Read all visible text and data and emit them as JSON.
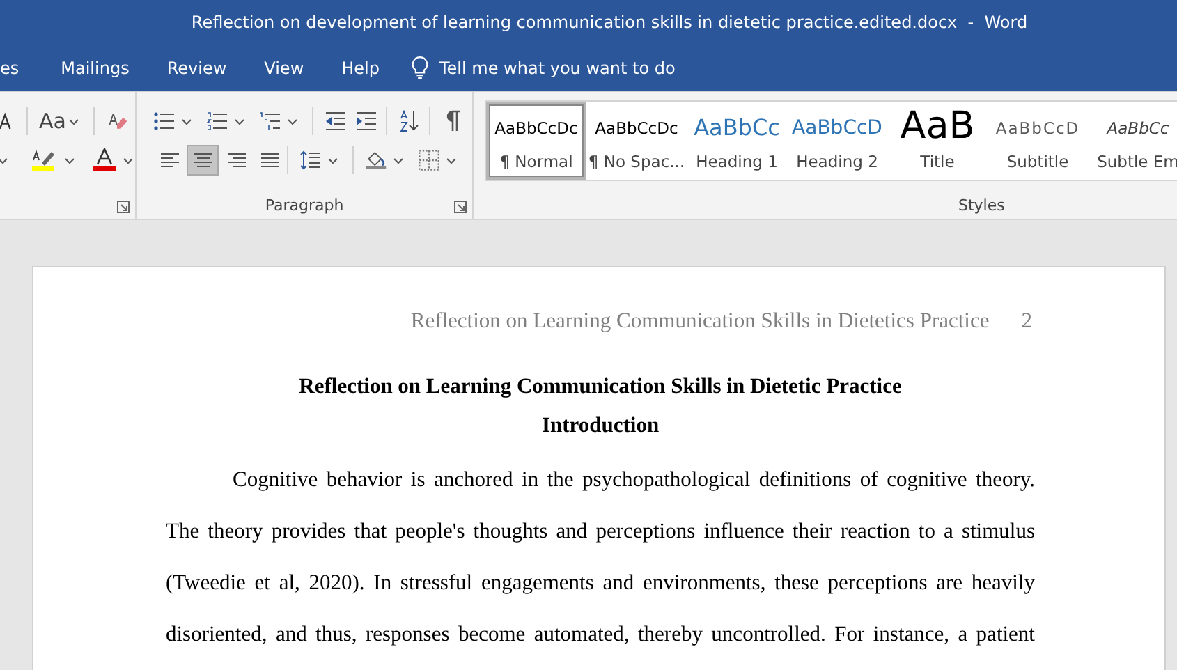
{
  "window": {
    "title": "Reflection on development of learning communication skills in dietetic practice.edited.docx  -  Word"
  },
  "tabs": [
    {
      "label": "es",
      "selected": false
    },
    {
      "label": "Mailings",
      "selected": false
    },
    {
      "label": "Review",
      "selected": false
    },
    {
      "label": "View",
      "selected": false
    },
    {
      "label": "Help",
      "selected": false
    }
  ],
  "tell_me": {
    "placeholder": "Tell me what you want to do"
  },
  "font_group": {
    "change_case": "Aa"
  },
  "paragraph_group": {
    "label": "Paragraph",
    "align_buttons": [
      {
        "selected": false
      },
      {
        "selected": true
      },
      {
        "selected": false
      },
      {
        "selected": false
      }
    ]
  },
  "styles_group": {
    "label": "Styles",
    "items": [
      {
        "preview": "AaBbCcDc",
        "name": "¶ Normal",
        "kind": "normal",
        "selected": true
      },
      {
        "preview": "AaBbCcDc",
        "name": "¶ No Spac...",
        "kind": "normal",
        "selected": false
      },
      {
        "preview": "AaBbCc",
        "name": "Heading 1",
        "kind": "heading1",
        "selected": false
      },
      {
        "preview": "AaBbCcD",
        "name": "Heading 2",
        "kind": "heading2",
        "selected": false
      },
      {
        "preview": "AaB",
        "name": "Title",
        "kind": "title",
        "selected": false
      },
      {
        "preview": "AaBbCcD",
        "name": "Subtitle",
        "kind": "subtitle",
        "selected": false
      },
      {
        "preview": "AaBbCc",
        "name": "Subtle Em",
        "kind": "emphasis",
        "selected": false
      }
    ]
  },
  "document": {
    "header": {
      "title": "Reflection on Learning Communication Skills in Dietetics Practice",
      "page_number": "2"
    },
    "title": "Reflection on Learning Communication Skills in Dietetic Practice",
    "heading": "Introduction",
    "body_lines": [
      "Cognitive behavior is anchored in the psychopathological definitions of cognitive theory.",
      "The theory provides that people's thoughts and perceptions influence their reaction to a stimulus",
      "(Tweedie et al, 2020). In stressful engagements and environments, these perceptions are heavily",
      "disoriented, and thus, responses become automated, thereby uncontrolled. For instance, a patient"
    ]
  }
}
